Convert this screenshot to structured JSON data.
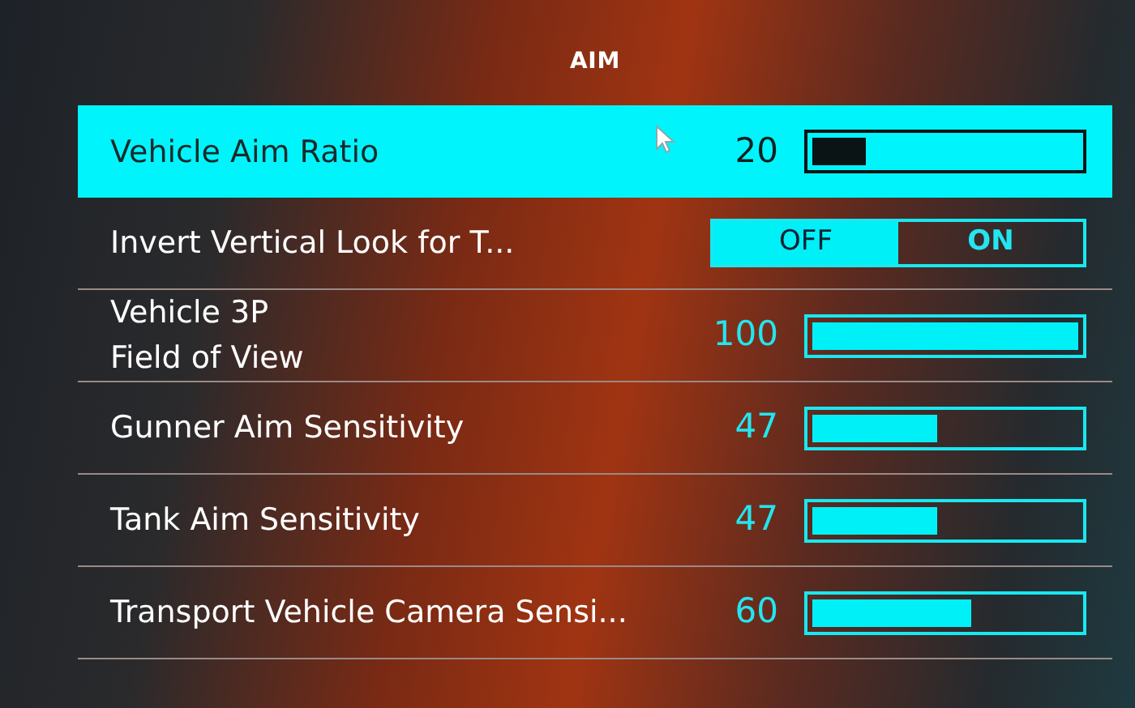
{
  "section": {
    "title": "AIM"
  },
  "settings": [
    {
      "kind": "slider",
      "label": "Vehicle Aim Ratio",
      "reading": "20",
      "level": 0.2,
      "selected": true
    },
    {
      "kind": "toggle",
      "label": "Invert Vertical Look for T...",
      "selected": false,
      "options": [
        {
          "label": "OFF",
          "selected": true
        },
        {
          "label": "ON",
          "selected": false
        }
      ]
    },
    {
      "kind": "slider",
      "label": "Vehicle 3P\nField of View",
      "reading": "100",
      "level": 1,
      "selected": false
    },
    {
      "kind": "slider",
      "label": "Gunner Aim Sensitivity",
      "reading": "47",
      "level": 0.47,
      "selected": false
    },
    {
      "kind": "slider",
      "label": "Tank Aim Sensitivity",
      "reading": "47",
      "level": 0.47,
      "selected": false
    },
    {
      "kind": "slider",
      "label": "Transport Vehicle Camera Sensi...",
      "reading": "60",
      "level": 0.6,
      "selected": false
    }
  ]
}
